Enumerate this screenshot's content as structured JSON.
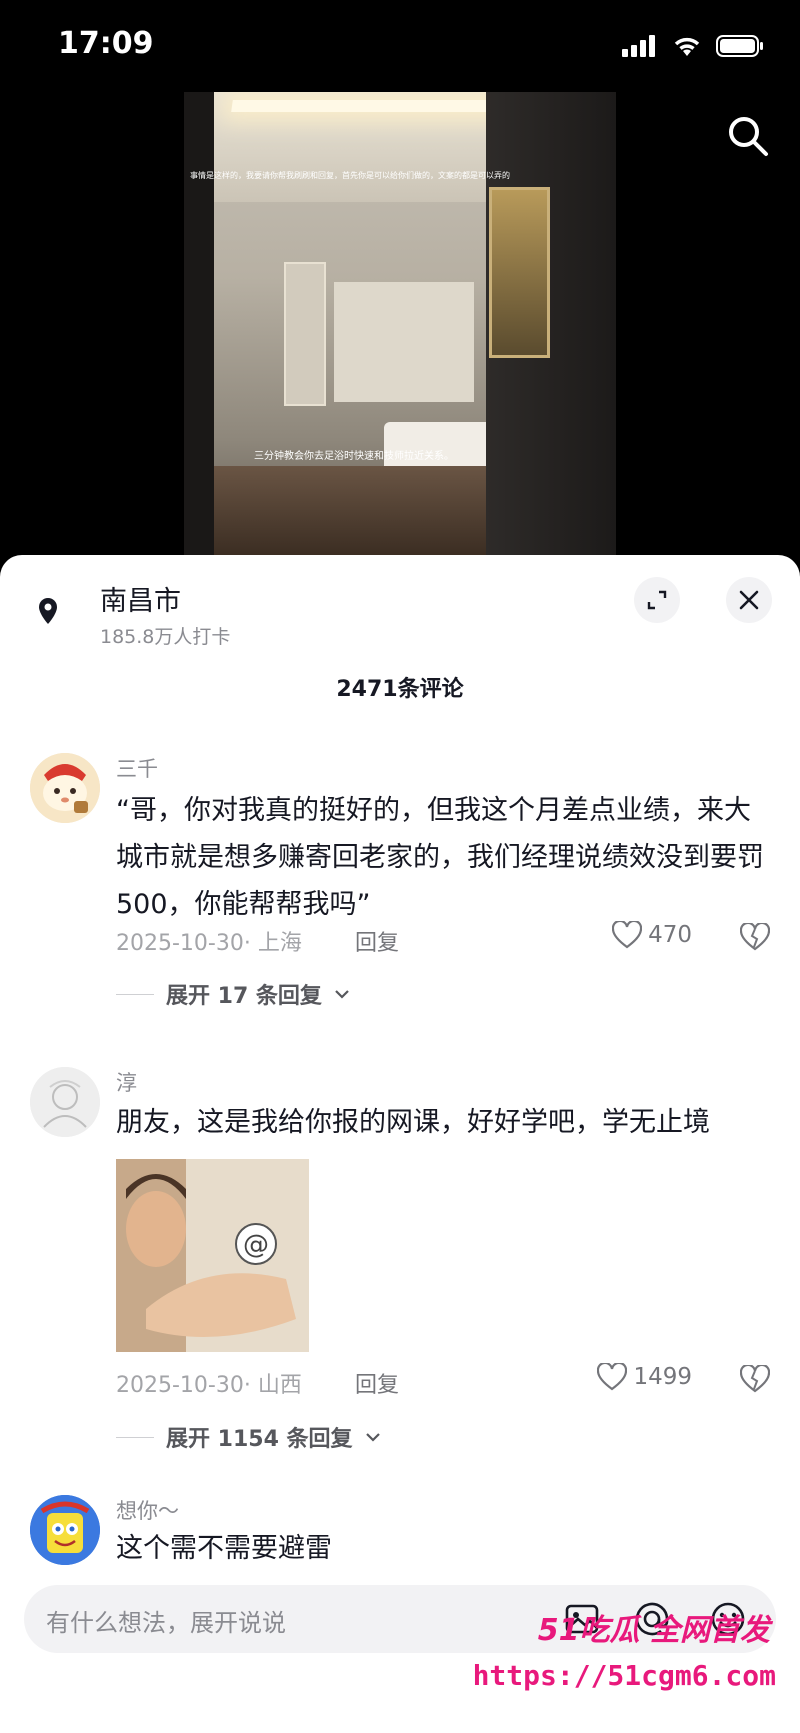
{
  "status_bar": {
    "time": "17:09"
  },
  "video": {
    "caption_top": "事情是这样的，我要请你帮我刷刷和回复，首先你是可以给你们做的，文案的都是可以弄的",
    "caption_bottom": "三分钟教会你去足浴时快速和技师拉近关系。"
  },
  "location": {
    "city": "南昌市",
    "checkins": "185.8万人打卡"
  },
  "comments_header": {
    "count_label": "2471条评论"
  },
  "comments": [
    {
      "user": "三千",
      "text": "“哥，你对我真的挺好的，但我这个月差点业绩，来大城市就是想多赚寄回老家的，我们经理说绩效没到要罚500，你能帮帮我吗”",
      "date_loc": "2025-10-30· 上海",
      "reply_label": "回复",
      "likes": "470",
      "expand_label": "展开 17 条回复"
    },
    {
      "user": "淳",
      "text": "朋友，这是我给你报的网课，好好学吧，学无止境",
      "date_loc": "2025-10-30· 山西",
      "reply_label": "回复",
      "likes": "1499",
      "expand_label": "展开 1154 条回复"
    },
    {
      "user": "想你～",
      "text": "这个需不需要避雷"
    }
  ],
  "input": {
    "placeholder": "有什么想法，展开说说"
  },
  "watermark": {
    "line1": "51吃瓜 全网首发",
    "line2": "https://51cgm6.com"
  },
  "colors": {
    "brand_pink": "#e8197c",
    "text_main": "#161823",
    "text_gray": "#8a8b91"
  }
}
